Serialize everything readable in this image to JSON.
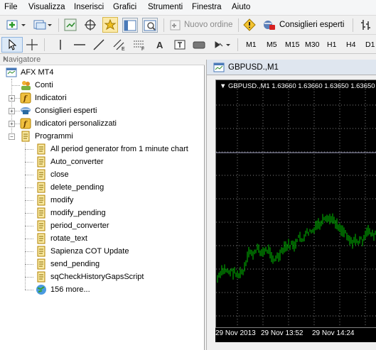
{
  "menu": [
    "File",
    "Visualizza",
    "Inserisci",
    "Grafici",
    "Strumenti",
    "Finestra",
    "Aiuto"
  ],
  "toolbar": {
    "new_order": "Nuovo ordine",
    "experts": "Consiglieri esperti"
  },
  "periods": [
    "M1",
    "M5",
    "M15",
    "M30",
    "H1",
    "H4",
    "D1"
  ],
  "navigator": {
    "title": "Navigatore",
    "close": "×",
    "root": "AFX MT4",
    "items": [
      {
        "label": "Conti",
        "icon": "accounts-icon"
      },
      {
        "label": "Indicatori",
        "icon": "indicators-icon"
      },
      {
        "label": "Consiglieri esperti",
        "icon": "experts-icon"
      },
      {
        "label": "Indicatori personalizzati",
        "icon": "custom-indicators-icon"
      },
      {
        "label": "Programmi",
        "icon": "scripts-icon"
      }
    ],
    "scripts": [
      "All period generator from 1 minute chart",
      "Auto_converter",
      "close",
      "delete_pending",
      "modify",
      "modify_pending",
      "period_converter",
      "rotate_text",
      "Sapienza COT Update",
      "send_pending",
      "sqCheckHistoryGapsScript"
    ],
    "more": "156 more..."
  },
  "chart": {
    "window_title": "GBPUSD.,M1",
    "header": "GBPUSD.,M1  1.63660 1.63660 1.63650 1.63650",
    "x_labels": [
      "29 Nov 2013",
      "29 Nov 13:52",
      "29 Nov 14:24"
    ],
    "bar_color": "#00c000",
    "grid_color": "#7f7f7f"
  }
}
